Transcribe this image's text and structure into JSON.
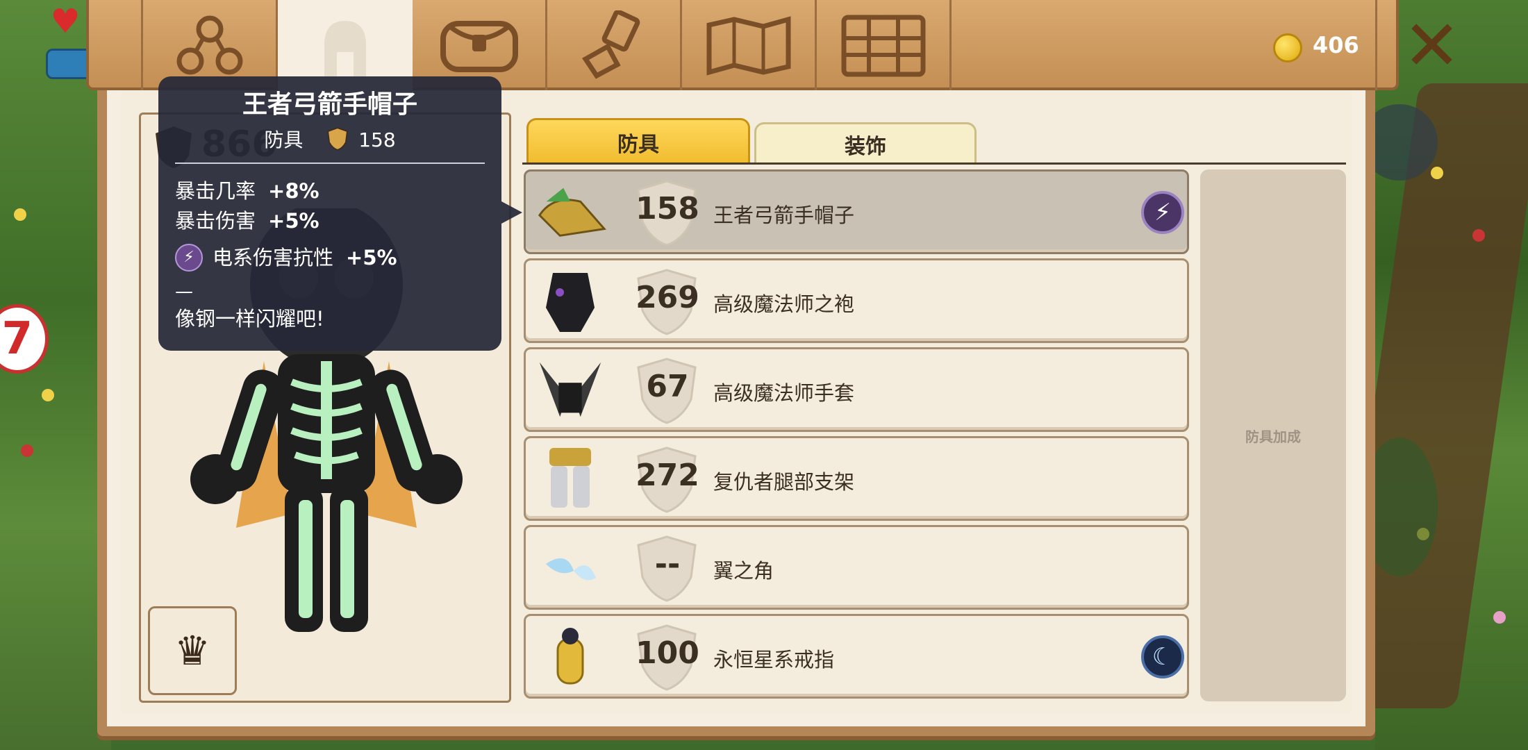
{
  "hud": {
    "badge_text": "7"
  },
  "topbar": {
    "tabs": [
      {
        "icon": "skills-icon",
        "active": false
      },
      {
        "icon": "helmet-icon",
        "active": true
      },
      {
        "icon": "bag-icon",
        "active": false
      },
      {
        "icon": "crafting-hammer-icon",
        "active": false
      },
      {
        "icon": "map-icon",
        "active": false
      },
      {
        "icon": "chest-icon",
        "active": false
      }
    ],
    "coins": "406"
  },
  "character": {
    "total_armor": "866"
  },
  "tooltip": {
    "title": "王者弓箭手帽子",
    "type": "防具",
    "armor": "158",
    "stats": [
      {
        "label": "暴击几率",
        "value": "+8%"
      },
      {
        "label": "暴击伤害",
        "value": "+5%"
      }
    ],
    "elemental": {
      "label": "电系伤害抗性",
      "value": "+5%"
    },
    "dash": "—",
    "flavor": "像钢一样闪耀吧!"
  },
  "categories": {
    "armor": "防具",
    "decoration": "装饰"
  },
  "items": [
    {
      "armor": "158",
      "name": "王者弓箭手帽子",
      "effect": "electric",
      "selected": true
    },
    {
      "armor": "269",
      "name": "高级魔法师之袍",
      "effect": "",
      "selected": false
    },
    {
      "armor": "67",
      "name": "高级魔法师手套",
      "effect": "",
      "selected": false
    },
    {
      "armor": "272",
      "name": "复仇者腿部支架",
      "effect": "",
      "selected": false
    },
    {
      "armor": "--",
      "name": "翼之角",
      "effect": "",
      "selected": false
    },
    {
      "armor": "100",
      "name": "永恒星系戒指",
      "effect": "moon",
      "selected": false
    }
  ],
  "craft_panel": {
    "label": "防具加成"
  },
  "colors": {
    "panel_bg": "#f6efe1",
    "wood": "#c48f55",
    "gold_tab": "#f0bc2e",
    "tooltip_bg": "#262838"
  }
}
